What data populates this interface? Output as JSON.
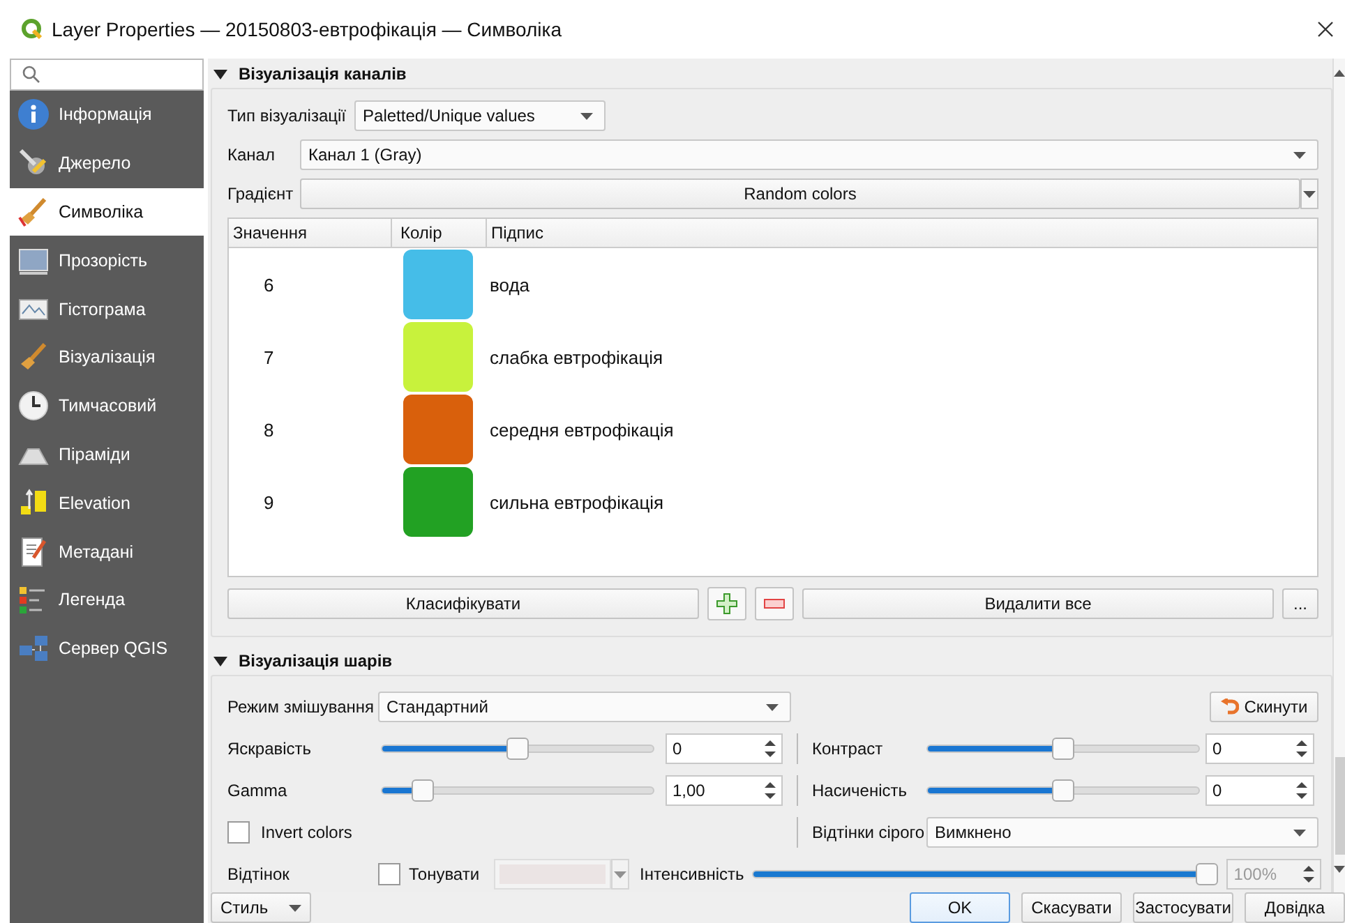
{
  "window": {
    "title": "Layer Properties — 20150803-евтрофікація — Символіка"
  },
  "sidebar": {
    "items": [
      {
        "label": "Інформація",
        "selected": false
      },
      {
        "label": "Джерело",
        "selected": false
      },
      {
        "label": "Символіка",
        "selected": true
      },
      {
        "label": "Прозорість",
        "selected": false
      },
      {
        "label": "Гістограма",
        "selected": false
      },
      {
        "label": "Візуалізація",
        "selected": false
      },
      {
        "label": "Тимчасовий",
        "selected": false
      },
      {
        "label": "Піраміди",
        "selected": false
      },
      {
        "label": "Elevation",
        "selected": false
      },
      {
        "label": "Метадані",
        "selected": false
      },
      {
        "label": "Легенда",
        "selected": false
      },
      {
        "label": "Сервер QGIS",
        "selected": false
      }
    ]
  },
  "band_section": {
    "title": "Візуалізація каналів",
    "expanded": true,
    "render_type": {
      "label": "Тип візуалізації",
      "value": "Paletted/Unique values"
    },
    "band": {
      "label": "Канал",
      "value": "Канал 1 (Gray)"
    },
    "gradient": {
      "label": "Градієнт",
      "value": "Random colors"
    },
    "table": {
      "columns": [
        "Значення",
        "Колір",
        "Підпис"
      ],
      "rows": [
        {
          "value": "6",
          "color": "#45bde8",
          "label": "вода"
        },
        {
          "value": "7",
          "color": "#c8f23c",
          "label": "слабка евтрофікація"
        },
        {
          "value": "8",
          "color": "#d9600c",
          "label": "середня евтрофікація"
        },
        {
          "value": "9",
          "color": "#22a123",
          "label": "сильна евтрофікація"
        }
      ]
    },
    "classify": "Класифікувати",
    "delete_all": "Видалити все",
    "more": "..."
  },
  "layer_section": {
    "title": "Візуалізація шарів",
    "expanded": true,
    "blending": {
      "label": "Режим змішування",
      "value": "Стандартний"
    },
    "reset": "Скинути",
    "brightness": {
      "label": "Яскравість",
      "level": 0.5,
      "value": "0"
    },
    "contrast": {
      "label": "Контраст",
      "level": 0.5,
      "value": "0"
    },
    "gamma": {
      "label": "Gamma",
      "level": 0.12,
      "value": "1,00"
    },
    "saturation": {
      "label": "Насиченість",
      "level": 0.5,
      "value": "0"
    },
    "invert": {
      "label": "Invert colors",
      "checked": false
    },
    "grayscale": {
      "label": "Відтінки сірого",
      "value": "Вимкнено"
    },
    "hue": {
      "label": "Відтінок"
    },
    "colorize": {
      "label": "Тонувати",
      "checked": false
    },
    "intensity": {
      "label": "Інтенсивність",
      "level": 1,
      "value": "100%",
      "disabled": true
    }
  },
  "footer": {
    "style": "Стиль",
    "buttons": [
      {
        "label": "OK",
        "primary": true
      },
      {
        "label": "Скасувати",
        "primary": false
      },
      {
        "label": "Застосувати",
        "primary": false
      },
      {
        "label": "Довідка",
        "primary": false
      }
    ]
  }
}
